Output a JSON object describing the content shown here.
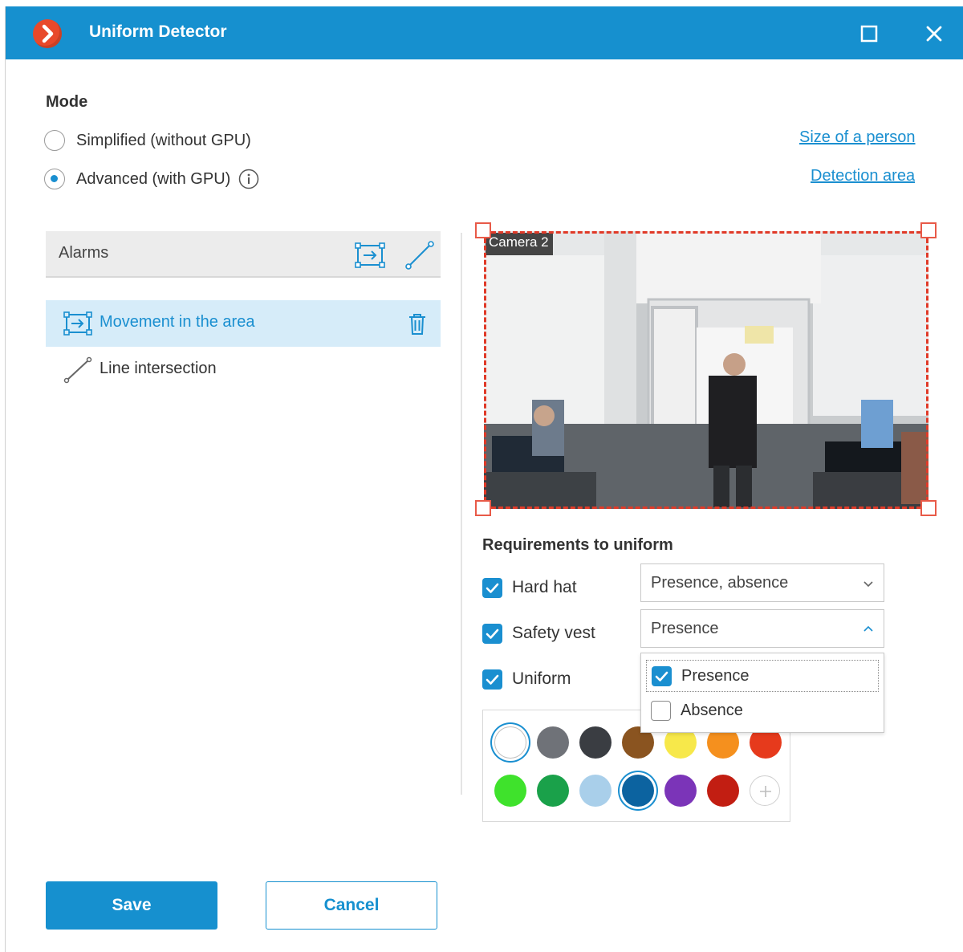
{
  "window": {
    "title": "Uniform Detector",
    "accent_color": "#1690cf",
    "controls": [
      "maximize-icon",
      "close-icon"
    ]
  },
  "mode": {
    "heading": "Mode",
    "options": [
      {
        "label": "Simplified (without GPU)",
        "selected": false
      },
      {
        "label": "Advanced (with GPU)",
        "selected": true
      }
    ]
  },
  "links": {
    "size_of_person": "Size of a person",
    "detection_area": "Detection area"
  },
  "alarms": {
    "header": "Alarms",
    "header_icons": [
      "area-alarm-icon",
      "line-alarm-icon"
    ],
    "items": [
      {
        "label": "Movement in the area",
        "icon": "area-alarm-icon",
        "selected": true
      },
      {
        "label": "Line intersection",
        "icon": "line-alarm-icon",
        "selected": false
      }
    ]
  },
  "camera": {
    "label": "Camera 2",
    "area_border_color": "#e03a28"
  },
  "requirements": {
    "heading": "Requirements to uniform",
    "items": [
      {
        "label": "Hard hat",
        "checked": true,
        "select_value": "Presence, absence",
        "open": false
      },
      {
        "label": "Safety vest",
        "checked": true,
        "select_value": "Presence",
        "open": true
      },
      {
        "label": "Uniform",
        "checked": true
      }
    ],
    "dropdown": {
      "options": [
        {
          "label": "Presence",
          "checked": true
        },
        {
          "label": "Absence",
          "checked": false
        }
      ]
    }
  },
  "palette": {
    "colors": [
      "#ffffff",
      "#6f7278",
      "#3a3d42",
      "#8a5420",
      "#f7e84a",
      "#f5901e",
      "#e63a1c",
      "#3fe22c",
      "#1aa14a",
      "#a9cfea",
      "#0c63a0",
      "#7b34b8",
      "#c21e12"
    ],
    "selected": [
      "#ffffff",
      "#0c63a0"
    ],
    "add_icon": "plus-icon"
  },
  "buttons": {
    "save": "Save",
    "cancel": "Cancel"
  }
}
